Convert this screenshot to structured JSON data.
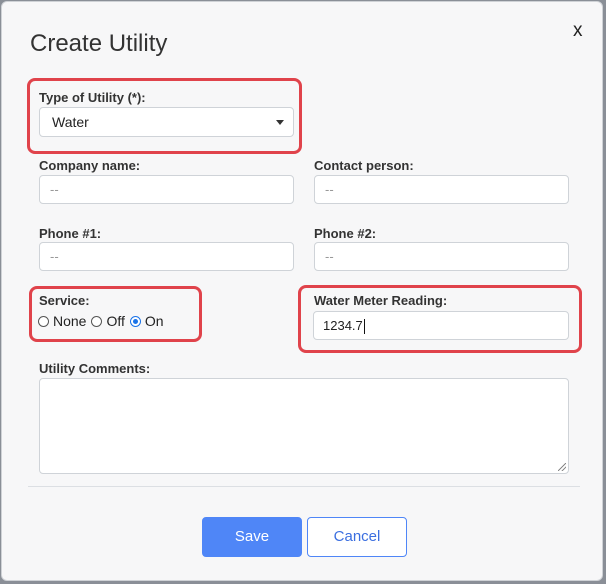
{
  "dialog": {
    "title": "Create Utility",
    "close_label": "x"
  },
  "type_of_utility": {
    "label": "Type of Utility (*):",
    "selected": "Water"
  },
  "company_name": {
    "label": "Company name:",
    "placeholder": "--"
  },
  "contact_person": {
    "label": "Contact person:",
    "placeholder": "--"
  },
  "phone1": {
    "label": "Phone #1:",
    "placeholder": "--"
  },
  "phone2": {
    "label": "Phone #2:",
    "placeholder": "--"
  },
  "service": {
    "label": "Service:",
    "options": [
      {
        "label": "None",
        "checked": false
      },
      {
        "label": "Off",
        "checked": false
      },
      {
        "label": "On",
        "checked": true
      }
    ]
  },
  "water_meter": {
    "label": "Water Meter Reading:",
    "value": "1234.7"
  },
  "utility_comments": {
    "label": "Utility Comments:"
  },
  "buttons": {
    "save": "Save",
    "cancel": "Cancel"
  },
  "colors": {
    "highlight": "#e0434b",
    "primary": "#4f86f7"
  }
}
